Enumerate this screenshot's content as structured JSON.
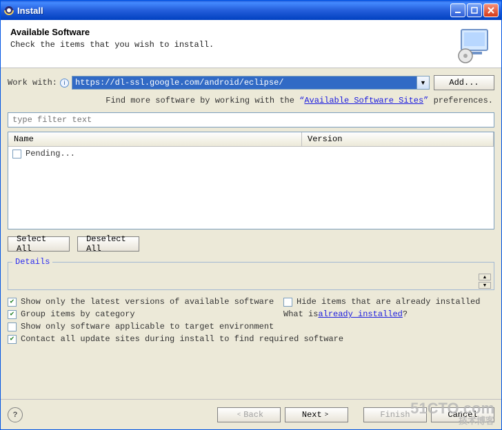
{
  "titlebar": {
    "title": "Install"
  },
  "banner": {
    "heading": "Available Software",
    "sub": "Check the items that you wish to install."
  },
  "workwith": {
    "label": "Work with:",
    "url": "https://dl-ssl.google.com/android/eclipse/",
    "add": "Add..."
  },
  "findmore": {
    "prefix": "Find more software by working with the ",
    "link": "Available Software Sites",
    "suffix": " preferences."
  },
  "filter": {
    "placeholder": "type filter text"
  },
  "tree": {
    "cols": {
      "name": "Name",
      "version": "Version"
    },
    "pending": "Pending..."
  },
  "selectbtns": {
    "all": "Select All",
    "none": "Deselect All"
  },
  "details": {
    "legend": "Details"
  },
  "checks": {
    "latest": "Show only the latest versions of available software",
    "hide": "Hide items that are already installed",
    "group": "Group items by category",
    "whatprefix": "What is ",
    "whatlink": "already installed",
    "whatsuffix": "?",
    "target": "Show only software applicable to target environment",
    "contact": "Contact all update sites during install to find required software"
  },
  "footer": {
    "back": "Back",
    "next": "Next",
    "finish": "Finish",
    "cancel": "Cancel"
  },
  "watermark": {
    "big": "51CTO.com",
    "small": "技术博客"
  }
}
